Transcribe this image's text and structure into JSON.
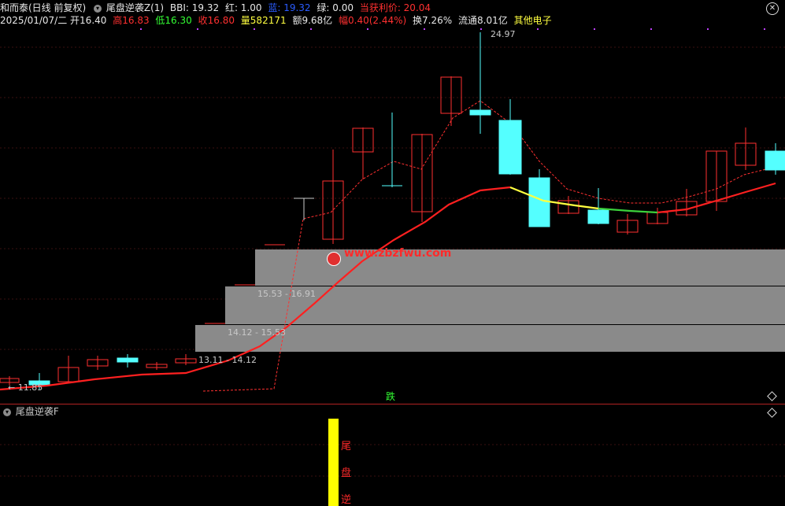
{
  "header": {
    "stock_title": "和而泰(日线 前复权)",
    "indicator_name": "尾盘逆袭Z(1)",
    "bbi_label": "BBI: 19.32",
    "red_label": "红: 1.00",
    "blue_label": "蓝: 19.32",
    "green_label": "绿: 0.00",
    "profit_label": "当获利价: 20.04",
    "date": "2025/01/07/二",
    "open_label": "开16.40",
    "high_label": "高16.83",
    "low_label": "低16.30",
    "close_label": "收16.80",
    "volume_label": "量582171",
    "amount_label": "额9.68亿",
    "change_label": "幅0.40(2.44%)",
    "turnover_label": "换7.26%",
    "float_label": "流通8.01亿",
    "sector_label": "其他电子"
  },
  "colors": {
    "background": "#000000",
    "up_candle": "#ff3030",
    "down_candle": "#54ffff",
    "bbi_line": "#ff2020",
    "bbi_yellow": "#ffff40",
    "bbi_green": "#3cd23c",
    "dashed_line": "#ff3030",
    "zone_fill": "#8a8a8a",
    "bar_yellow": "#ffff00"
  },
  "chart": {
    "peak_label": "24.97",
    "low_label": "11.85",
    "zones": [
      {
        "label": "13.11 - 14.12"
      },
      {
        "label": "14.12 - 15.53"
      },
      {
        "label": "15.53 - 16.91"
      }
    ]
  },
  "watermark": "www.zbzfwu.com",
  "signal_die": "跌",
  "sub_panel": {
    "title": "尾盘逆袭F",
    "vertical_text": [
      "尾",
      "盘",
      "逆"
    ]
  },
  "icons": {
    "dropdown": "chevron-down-icon",
    "close": "close-icon",
    "diamond": "diamond-icon"
  }
}
